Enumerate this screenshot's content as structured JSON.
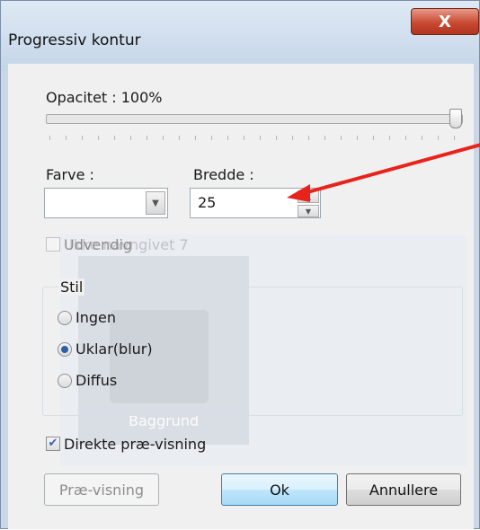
{
  "dialog": {
    "title": "Progressiv kontur",
    "close_label": "X"
  },
  "opacity": {
    "label": "Opacitet : 100%",
    "value_percent": 100
  },
  "color": {
    "label": "Farve :",
    "value": ""
  },
  "width": {
    "label": "Bredde :",
    "value": "25"
  },
  "outside": {
    "label": "Udvendig",
    "checked": false,
    "enabled": false
  },
  "style": {
    "group_label": "Stil",
    "options": [
      {
        "label": "Ingen",
        "checked": false
      },
      {
        "label": "Uklar(blur)",
        "checked": true
      },
      {
        "label": "Diffus",
        "checked": false
      }
    ]
  },
  "live_preview": {
    "label": "Direkte præ-visning",
    "checked": true
  },
  "buttons": {
    "preview": "Præ-visning",
    "ok": "Ok",
    "cancel": "Annullere"
  },
  "background_window": {
    "title": "Ikke navngivet 7",
    "caption": "Baggrund"
  },
  "colors": {
    "annotation_arrow": "#e8231b",
    "accent": "#2b5fa8"
  }
}
